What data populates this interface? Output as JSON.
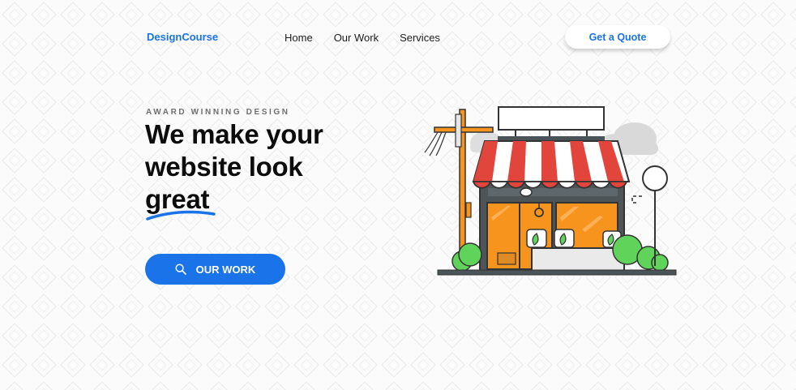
{
  "header": {
    "logo": "DesignCourse",
    "nav": [
      "Home",
      "Our Work",
      "Services"
    ],
    "cta_label": "Get a Quote"
  },
  "hero": {
    "eyebrow": "AWARD WINNING DESIGN",
    "headline_lines": [
      "We make your",
      "website look",
      "great"
    ],
    "button_label": "OUR WORK",
    "button_icon": "search-icon",
    "illustration": "storefront-illustration"
  },
  "colors": {
    "accent": "#1a73e8",
    "heading": "#0c0c0c",
    "awning_red": "#e2453c",
    "window_orange": "#f7941d",
    "bush_green": "#5fd35a"
  }
}
